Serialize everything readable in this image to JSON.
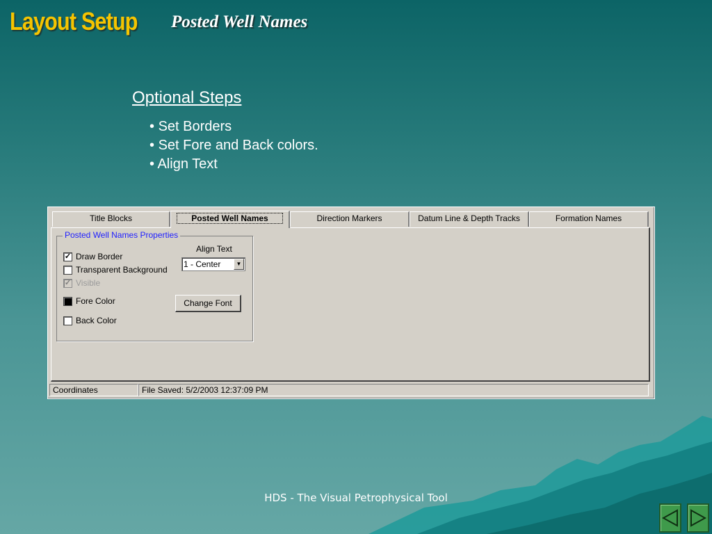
{
  "slide": {
    "title": "Layout Setup",
    "subtitle": "Posted Well Names",
    "steps_heading": "Optional Steps",
    "steps": [
      "Set Borders",
      "Set Fore and Back colors.",
      "Align Text"
    ],
    "footer": "HDS - The Visual Petrophysical Tool"
  },
  "window": {
    "tabs": [
      "Title Blocks",
      "Posted Well Names",
      "Direction Markers",
      "Datum Line & Depth Tracks",
      "Formation Names"
    ],
    "active_tab": "Posted Well Names",
    "group_title": "Posted Well Names Properties",
    "checkboxes": {
      "draw_border": {
        "label": "Draw Border",
        "checked": true
      },
      "transparent_background": {
        "label": "Transparent Background",
        "checked": false
      },
      "visible": {
        "label": "Visible",
        "checked": true,
        "disabled": true
      }
    },
    "fore_color": {
      "label": "Fore Color",
      "color": "#000000"
    },
    "back_color": {
      "label": "Back Color",
      "color": "#ffffff"
    },
    "align_text": {
      "label": "Align Text",
      "selected": "1 - Center"
    },
    "change_font_label": "Change Font",
    "status_bar": {
      "left": "Coordinates",
      "right": "File Saved: 5/2/2003 12:37:09 PM"
    }
  },
  "colors": {
    "title": "#f5c400",
    "nav_button": "#3f9a4b",
    "group_title": "#2020ff"
  },
  "icons": {
    "prev": "left-triangle-icon",
    "next": "right-triangle-icon"
  }
}
